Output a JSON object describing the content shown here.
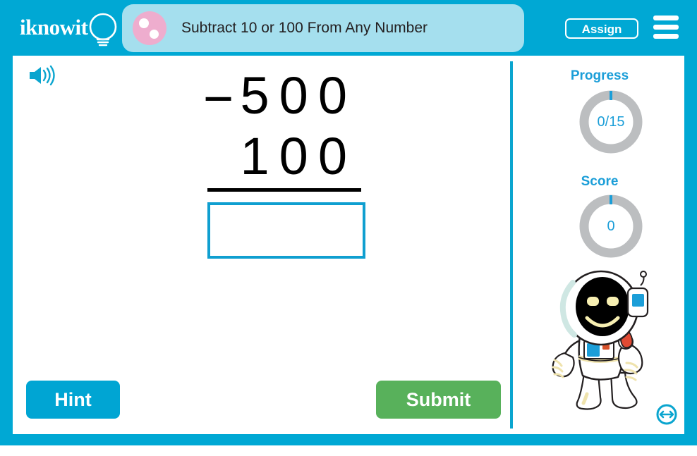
{
  "header": {
    "logo_text": "iknowit",
    "logo_icon": "lightbulb-icon",
    "title": "Subtract 10 or 100 From Any Number",
    "badge_icon": "pink-dots-badge",
    "assign_label": "Assign",
    "menu_icon": "hamburger-menu-icon",
    "bar_color": "#00a8d4",
    "pill_color": "#a5dfee",
    "badge_color": "#eeadce"
  },
  "content": {
    "speaker_icon": "audio-speaker-icon",
    "problem": {
      "minuend": "500",
      "subtrahend": "100",
      "operator": "−",
      "answer_value": "",
      "answer_placeholder": ""
    },
    "hint_label": "Hint",
    "submit_label": "Submit",
    "hint_color": "#00a5d3",
    "submit_color": "#58b15b",
    "answer_border_color": "#0f9fd0"
  },
  "sidebar": {
    "progress_label": "Progress",
    "progress_value": "0/15",
    "score_label": "Score",
    "score_value": "0",
    "ring_track_color": "#bcbec0",
    "ring_tick_color": "#1b9ed8",
    "accent_color": "#1b9ed8",
    "mascot_icon": "astronaut-mascot",
    "next_icon": "next-arrow-icon"
  }
}
